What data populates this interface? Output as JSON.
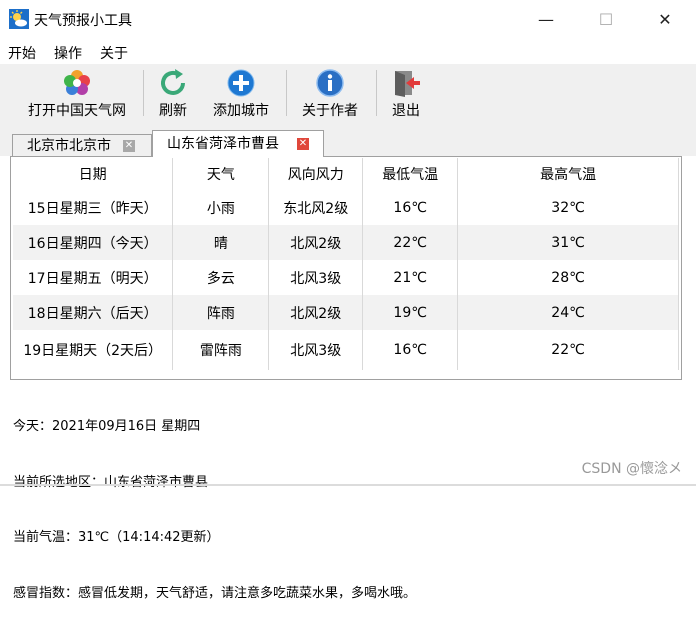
{
  "window": {
    "title": "天气预报小工具",
    "controls": {
      "minimize": "—",
      "maximize": "☐",
      "close": "✕"
    }
  },
  "menu": [
    "开始",
    "操作",
    "关于"
  ],
  "toolbar": [
    {
      "label": "打开中国天气网",
      "icon": "rainbow-flower-icon"
    },
    {
      "label": "刷新",
      "icon": "refresh-icon"
    },
    {
      "label": "添加城市",
      "icon": "add-icon"
    },
    {
      "label": "关于作者",
      "icon": "info-icon"
    },
    {
      "label": "退出",
      "icon": "exit-door-icon"
    }
  ],
  "tabs": [
    {
      "label": "北京市北京市",
      "active": false
    },
    {
      "label": "山东省菏泽市曹县",
      "active": true
    }
  ],
  "table": {
    "headers": [
      "日期",
      "天气",
      "风向风力",
      "最低气温",
      "最高气温"
    ],
    "rows": [
      [
        "15日星期三（昨天）",
        "小雨",
        "东北风2级",
        "16℃",
        "32℃"
      ],
      [
        "16日星期四（今天）",
        "晴",
        "北风2级",
        "22℃",
        "31℃"
      ],
      [
        "17日星期五（明天）",
        "多云",
        "北风3级",
        "21℃",
        "28℃"
      ],
      [
        "18日星期六（后天）",
        "阵雨",
        "北风2级",
        "19℃",
        "24℃"
      ],
      [
        "19日星期天（2天后）",
        "雷阵雨",
        "北风3级",
        "16℃",
        "22℃"
      ]
    ]
  },
  "info": {
    "today": "今天：2021年09月16日 星期四",
    "region": "当前所选地区：山东省菏泽市曹县",
    "temp": "当前气温：31℃（14:14:42更新）",
    "cold": "感冒指数：感冒低发期，天气舒适，请注意多吃蔬菜水果，多喝水哦。"
  },
  "watermark": "CSDN @懷淰メ",
  "colors": {
    "accent_blue": "#1e78d2",
    "close_red": "#e0473b",
    "alt_row": "#f2f2f2"
  }
}
